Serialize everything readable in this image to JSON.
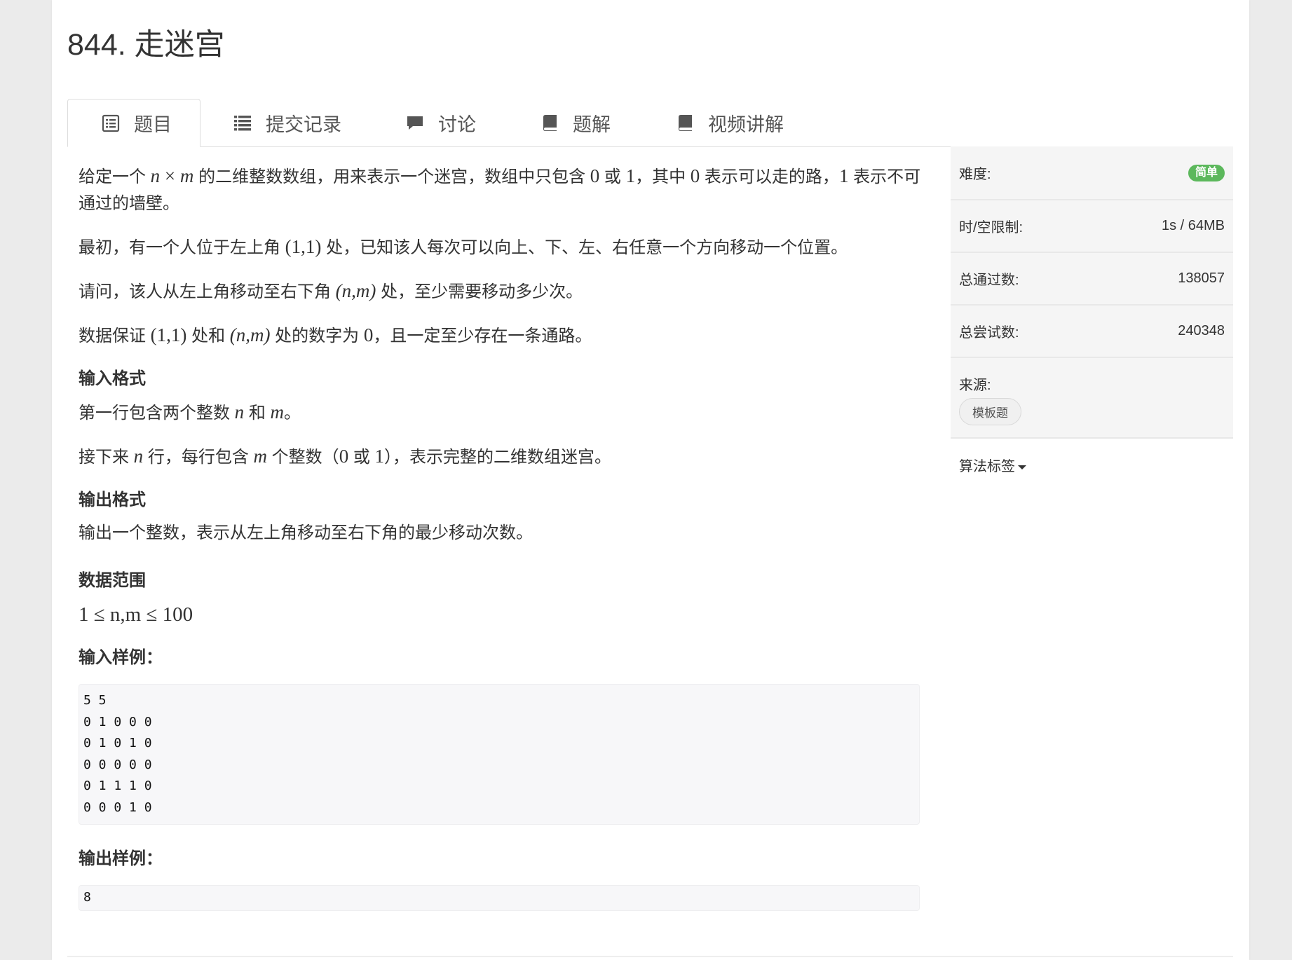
{
  "problem": {
    "title": "844. 走迷宫"
  },
  "tabs": [
    {
      "label": "题目",
      "icon": "list-alt-icon"
    },
    {
      "label": "提交记录",
      "icon": "list-icon"
    },
    {
      "label": "讨论",
      "icon": "comment-icon"
    },
    {
      "label": "题解",
      "icon": "book-icon"
    },
    {
      "label": "视频讲解",
      "icon": "book-icon"
    }
  ],
  "description": {
    "p1": [
      "给定一个 ",
      "n",
      " × ",
      "m",
      " 的二维整数数组，用来表示一个迷宫，数组中只包含 ",
      "0",
      " 或 ",
      "1",
      "，其中 ",
      "0",
      " 表示可以走的路，",
      "1",
      " 表示不可通过的墙壁。"
    ],
    "p2": [
      "最初，有一个人位于左上角 ",
      "(1,1)",
      " 处，已知该人每次可以向上、下、左、右任意一个方向移动一个位置。"
    ],
    "p3": [
      "请问，该人从左上角移动至右下角 ",
      "(n,m)",
      " 处，至少需要移动多少次。"
    ],
    "p4": [
      "数据保证 ",
      "(1,1)",
      " 处和 ",
      "(n,m)",
      " 处的数字为 ",
      "0",
      "，且一定至少存在一条通路。"
    ]
  },
  "input_format": {
    "heading": "输入格式",
    "p1": [
      "第一行包含两个整数 ",
      "n",
      " 和 ",
      "m",
      "。"
    ],
    "p2": [
      "接下来 ",
      "n",
      " 行，每行包含 ",
      "m",
      " 个整数（",
      "0",
      " 或 ",
      "1",
      "），表示完整的二维数组迷宫。"
    ]
  },
  "output_format": {
    "heading": "输出格式",
    "text": "输出一个整数，表示从左上角移动至右下角的最少移动次数。"
  },
  "data_range": {
    "heading": "数据范围",
    "text": "1 ≤ n,m ≤ 100"
  },
  "sample_input": {
    "heading": "输入样例：",
    "code": "5 5\n0 1 0 0 0\n0 1 0 1 0\n0 0 0 0 0\n0 1 1 1 0\n0 0 0 1 0"
  },
  "sample_output": {
    "heading": "输出样例：",
    "code": "8"
  },
  "sidebar": {
    "difficulty_label": "难度:",
    "difficulty_value": "简单",
    "difficulty_color": "#5cb85c",
    "limit_label": "时/空限制:",
    "limit_value": "1s / 64MB",
    "passed_label": "总通过数:",
    "passed_value": "138057",
    "attempts_label": "总尝试数:",
    "attempts_value": "240348",
    "source_label": "来源:",
    "source_tag": "模板题",
    "tags_label": "算法标签"
  }
}
